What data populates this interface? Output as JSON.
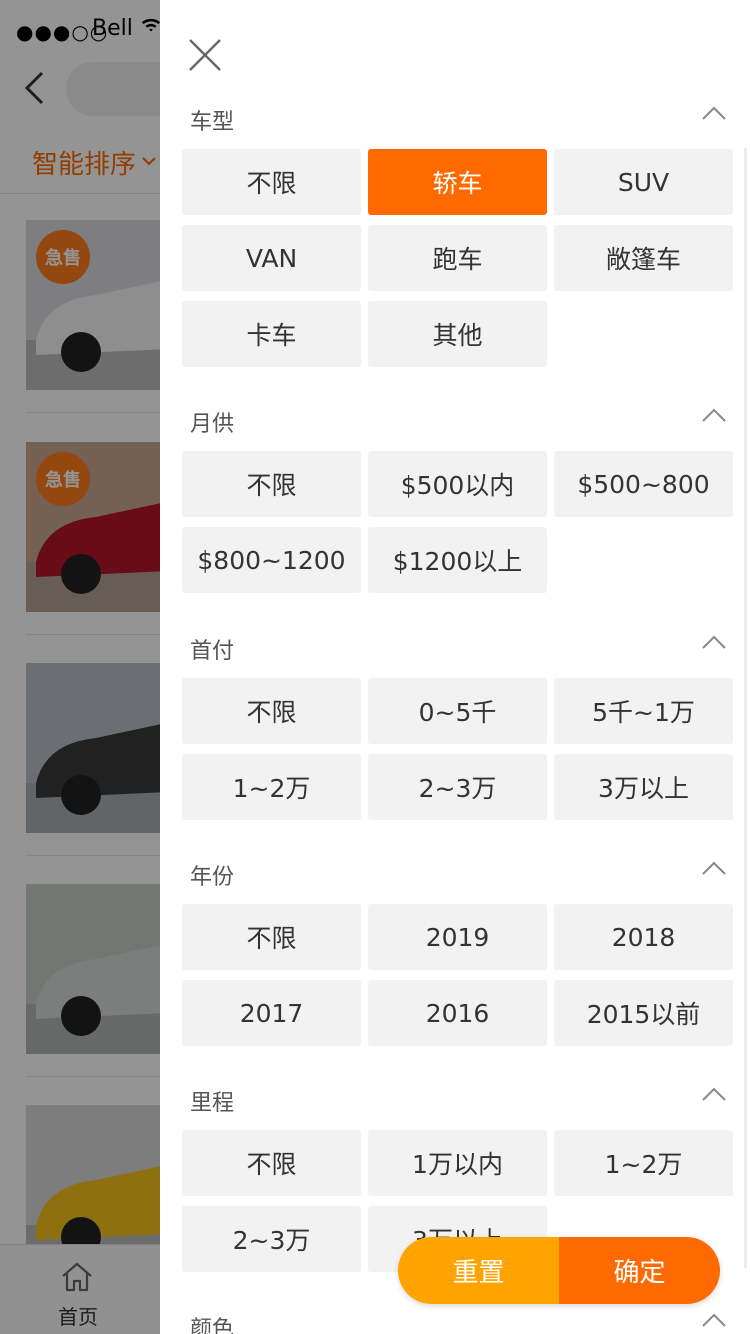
{
  "status_bar": {
    "signal": "●●●○○",
    "carrier": "Bell"
  },
  "sort_bar": {
    "label": "智能排序"
  },
  "listings": [
    {
      "badge": "急售",
      "thumb_color": "#d9d9dc",
      "car_color": "#f4f4f4"
    },
    {
      "badge": "急售",
      "thumb_color": "#c9a88f",
      "car_color": "#b3152a"
    },
    {
      "badge": "",
      "thumb_color": "#b8c0c8",
      "car_color": "#3a3a3c"
    },
    {
      "badge": "",
      "thumb_color": "#c4cdc9",
      "car_color": "#d6d7d8"
    },
    {
      "badge": "",
      "thumb_color": "#d8d8d8",
      "car_color": "#f4c21c"
    }
  ],
  "tabbar": {
    "home_label": "首页"
  },
  "filter": {
    "sections": [
      {
        "title": "车型",
        "options": [
          "不限",
          "轿车",
          "SUV",
          "VAN",
          "跑车",
          "敞篷车",
          "卡车",
          "其他"
        ],
        "selected_index": 1
      },
      {
        "title": "月供",
        "options": [
          "不限",
          "$500以内",
          "$500~800",
          "$800~1200",
          "$1200以上"
        ],
        "selected_index": -1
      },
      {
        "title": "首付",
        "options": [
          "不限",
          "0~5千",
          "5千~1万",
          "1~2万",
          "2~3万",
          "3万以上"
        ],
        "selected_index": -1
      },
      {
        "title": "年份",
        "options": [
          "不限",
          "2019",
          "2018",
          "2017",
          "2016",
          "2015以前"
        ],
        "selected_index": -1
      },
      {
        "title": "里程",
        "options": [
          "不限",
          "1万以内",
          "1~2万",
          "2~3万",
          "3万以上"
        ],
        "selected_index": -1
      },
      {
        "title": "颜色",
        "options": [],
        "selected_index": -1
      }
    ],
    "reset_label": "重置",
    "confirm_label": "确定"
  },
  "colors": {
    "accent": "#ff6a00",
    "reset": "#ffa300",
    "chip_bg": "#f2f2f2"
  }
}
